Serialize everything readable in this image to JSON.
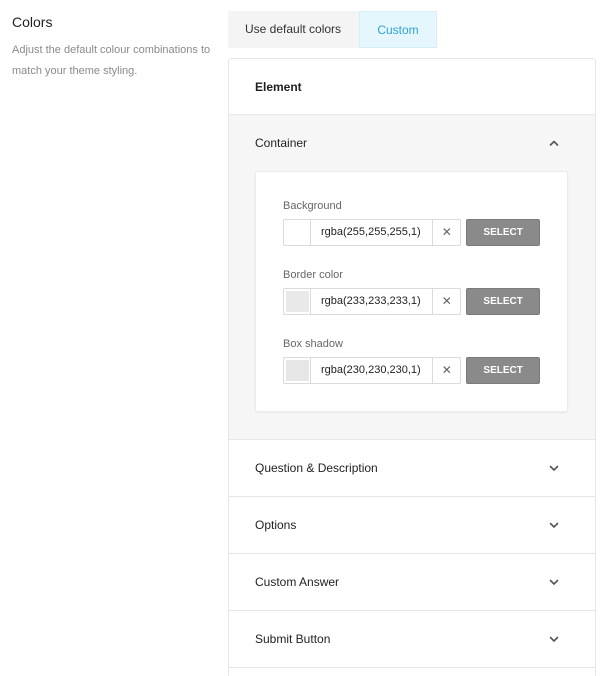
{
  "intro": {
    "title": "Colors",
    "description": "Adjust the default colour combinations to match your theme styling."
  },
  "mode_tabs": {
    "default_label": "Use default colors",
    "custom_label": "Custom",
    "active": "Custom"
  },
  "panel": {
    "element_label": "Element",
    "open_section": {
      "title": "Container",
      "icon": "chevron-up-icon",
      "fields": [
        {
          "label": "Background",
          "value": "rgba(255,255,255,1)",
          "swatch_color": "#ffffff",
          "clear_icon": "close-icon",
          "button_label": "SELECT"
        },
        {
          "label": "Border color",
          "value": "rgba(233,233,233,1)",
          "swatch_color": "#e9e9e9",
          "clear_icon": "close-icon",
          "button_label": "SELECT"
        },
        {
          "label": "Box shadow",
          "value": "rgba(230,230,230,1)",
          "swatch_color": "#e6e6e6",
          "clear_icon": "close-icon",
          "button_label": "SELECT"
        }
      ]
    },
    "collapsed_sections": [
      {
        "title": "Question & Description",
        "icon": "chevron-down-icon"
      },
      {
        "title": "Options",
        "icon": "chevron-down-icon"
      },
      {
        "title": "Custom Answer",
        "icon": "chevron-down-icon"
      },
      {
        "title": "Submit Button",
        "icon": "chevron-down-icon"
      }
    ]
  },
  "colors": {
    "accent": "#2ea3d6",
    "select_button": "#8a8a8a",
    "open_section_bg": "#f6f6f6"
  }
}
